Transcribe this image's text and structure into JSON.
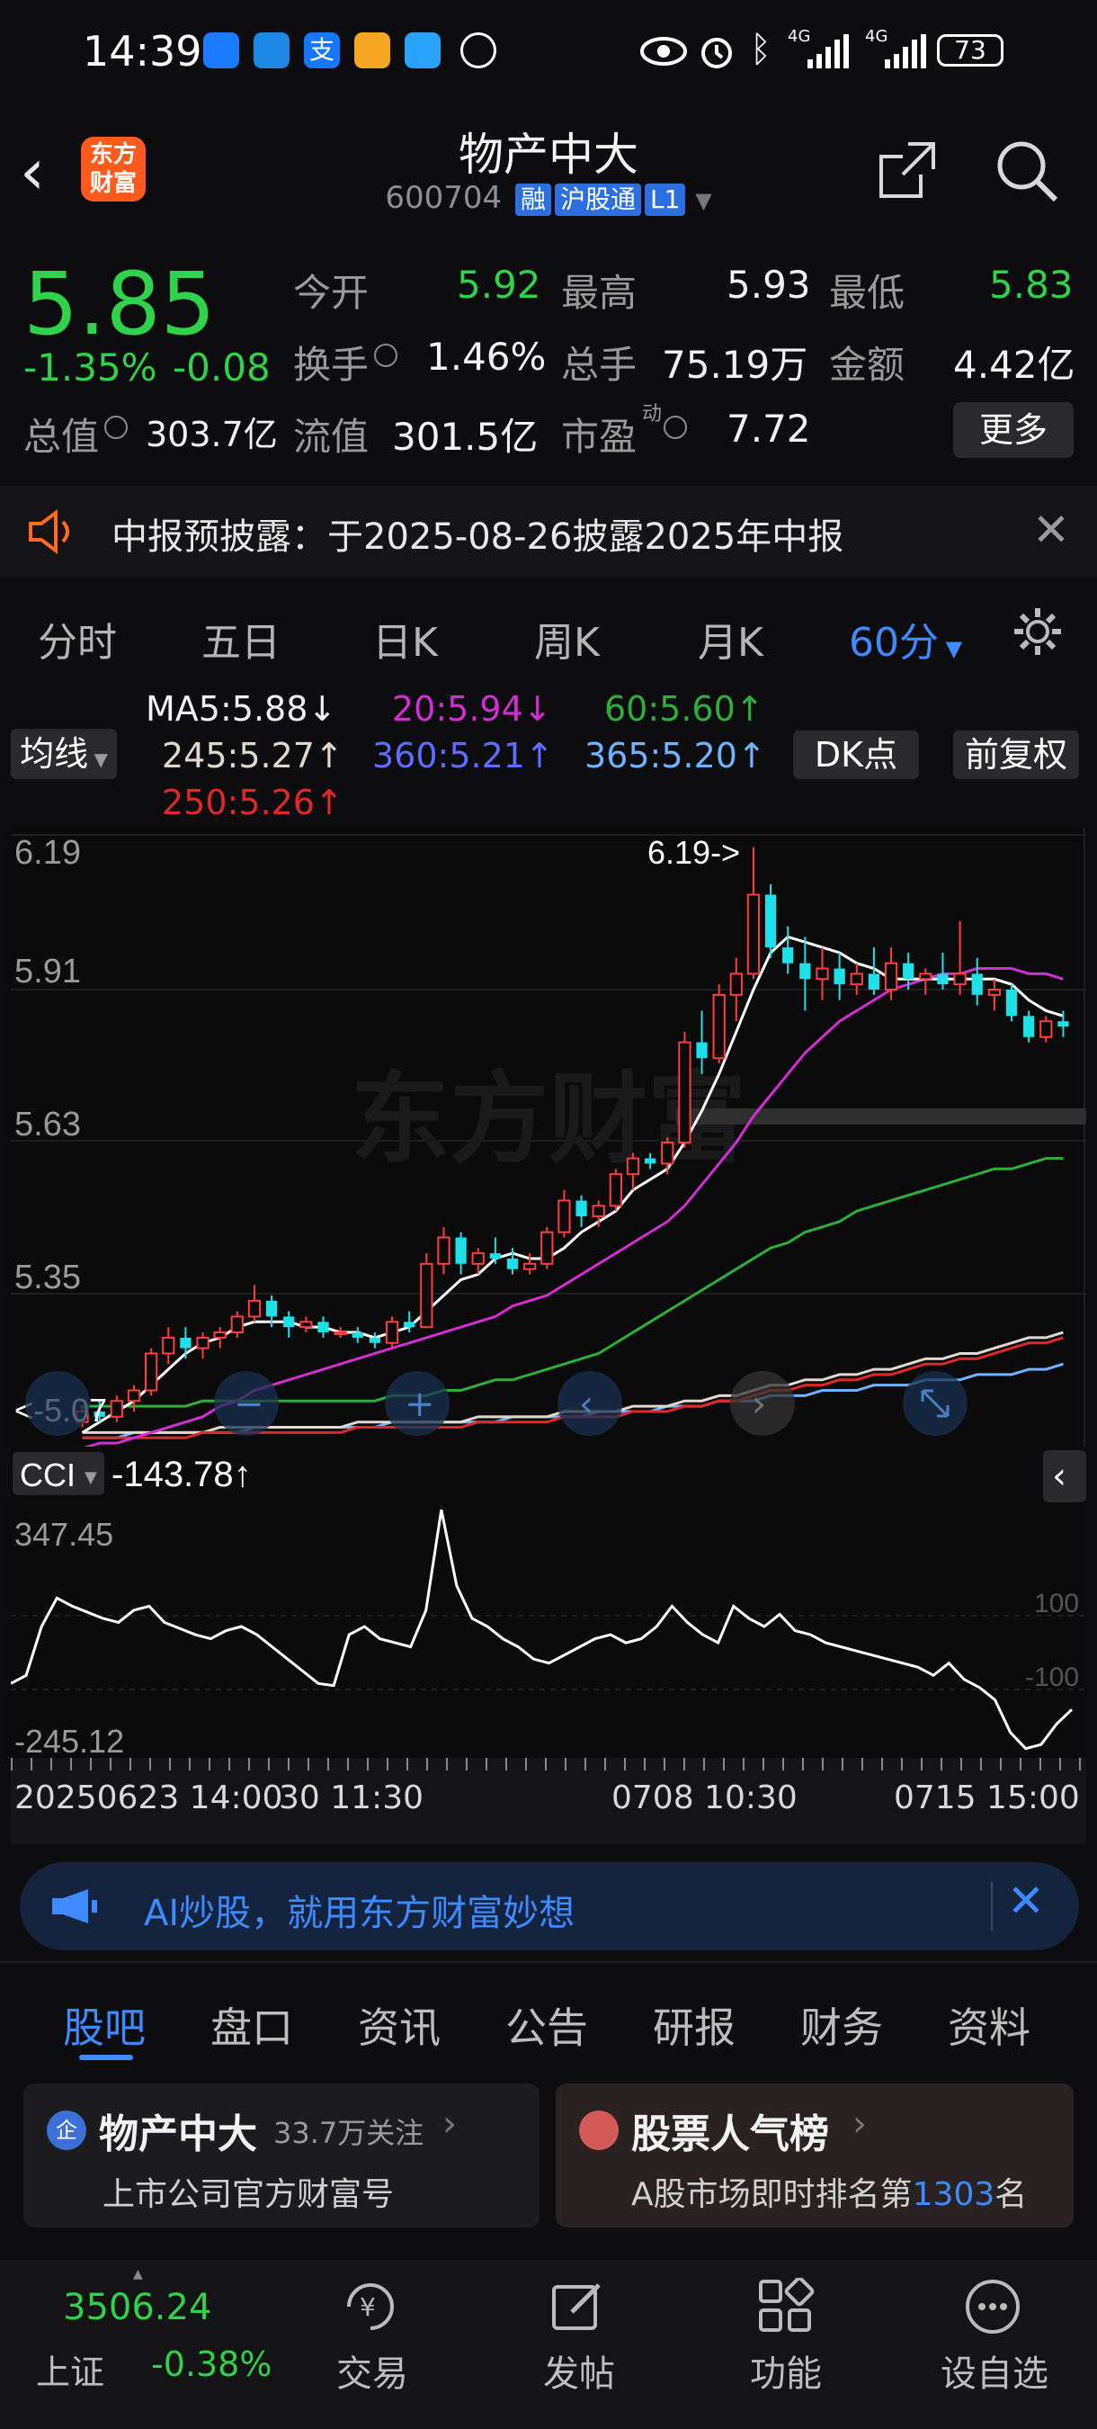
{
  "status_bar": {
    "time": "14:39",
    "battery": "73",
    "signal_1": "4G",
    "signal_2": "4G"
  },
  "header": {
    "title": "物产中大",
    "code": "600704",
    "tag_rong": "融",
    "tag_hgt": "沪股通",
    "tag_level": "L1",
    "logo_text": "东方\n财富"
  },
  "quote": {
    "price": "5.85",
    "change_pct": "-1.35%",
    "change_abs": "-0.08",
    "open_label": "今开",
    "open": "5.92",
    "high_label": "最高",
    "high": "5.93",
    "low_label": "最低",
    "low": "5.83",
    "turnover_label": "换手",
    "turnover": "1.46%",
    "volume_label": "总手",
    "volume": "75.19万",
    "amount_label": "金额",
    "amount": "4.42亿",
    "mktcap_label": "总值",
    "mktcap": "303.7亿",
    "float_label": "流值",
    "float": "301.5亿",
    "pe_label": "市盈",
    "pe_sup": "动",
    "pe": "7.72",
    "more": "更多"
  },
  "notice": {
    "text": "中报预披露：于2025-08-26披露2025年中报"
  },
  "period_tabs": [
    "分时",
    "五日",
    "日K",
    "周K",
    "月K",
    "60分"
  ],
  "indicators": {
    "ma_button": "均线",
    "ma5": "MA5:5.88↓",
    "ma20": "20:5.94↓",
    "ma60": "60:5.60↑",
    "ma245": "245:5.27↑",
    "ma360": "360:5.21↑",
    "ma365": "365:5.20↑",
    "ma250": "250:5.26↑",
    "dk_button": "DK点",
    "fq_button": "前复权"
  },
  "chart_data": {
    "type": "candlestick",
    "y_ticks": [
      "6.19",
      "5.91",
      "5.63",
      "5.35"
    ],
    "ylim": [
      5.05,
      6.21
    ],
    "max_marker": "6.19->",
    "min_marker": "<-5.07",
    "x_labels": [
      "20250623 14:00",
      "30 11:30",
      "0708 10:30",
      "0715 15:00"
    ],
    "watermark": "东方财富",
    "candles": [
      [
        5.1,
        5.13,
        5.09,
        5.12
      ],
      [
        5.12,
        5.14,
        5.1,
        5.11
      ],
      [
        5.11,
        5.15,
        5.1,
        5.14
      ],
      [
        5.14,
        5.17,
        5.12,
        5.16
      ],
      [
        5.16,
        5.24,
        5.15,
        5.23
      ],
      [
        5.23,
        5.28,
        5.21,
        5.26
      ],
      [
        5.26,
        5.28,
        5.22,
        5.24
      ],
      [
        5.24,
        5.27,
        5.22,
        5.26
      ],
      [
        5.26,
        5.28,
        5.24,
        5.27
      ],
      [
        5.27,
        5.31,
        5.26,
        5.3
      ],
      [
        5.3,
        5.36,
        5.29,
        5.33
      ],
      [
        5.33,
        5.34,
        5.28,
        5.3
      ],
      [
        5.3,
        5.31,
        5.26,
        5.28
      ],
      [
        5.28,
        5.3,
        5.27,
        5.29
      ],
      [
        5.29,
        5.3,
        5.26,
        5.27
      ],
      [
        5.27,
        5.28,
        5.26,
        5.27
      ],
      [
        5.27,
        5.28,
        5.25,
        5.26
      ],
      [
        5.26,
        5.27,
        5.24,
        5.25
      ],
      [
        5.25,
        5.3,
        5.24,
        5.29
      ],
      [
        5.29,
        5.31,
        5.27,
        5.28
      ],
      [
        5.28,
        5.42,
        5.28,
        5.4
      ],
      [
        5.4,
        5.47,
        5.38,
        5.45
      ],
      [
        5.45,
        5.46,
        5.38,
        5.4
      ],
      [
        5.4,
        5.43,
        5.38,
        5.42
      ],
      [
        5.42,
        5.45,
        5.4,
        5.41
      ],
      [
        5.41,
        5.43,
        5.38,
        5.39
      ],
      [
        5.39,
        5.42,
        5.38,
        5.4
      ],
      [
        5.4,
        5.47,
        5.39,
        5.46
      ],
      [
        5.46,
        5.54,
        5.45,
        5.52
      ],
      [
        5.52,
        5.53,
        5.47,
        5.49
      ],
      [
        5.49,
        5.52,
        5.47,
        5.51
      ],
      [
        5.51,
        5.58,
        5.5,
        5.57
      ],
      [
        5.57,
        5.61,
        5.54,
        5.6
      ],
      [
        5.6,
        5.61,
        5.58,
        5.59
      ],
      [
        5.59,
        5.64,
        5.57,
        5.63
      ],
      [
        5.63,
        5.84,
        5.62,
        5.82
      ],
      [
        5.82,
        5.88,
        5.76,
        5.79
      ],
      [
        5.79,
        5.93,
        5.78,
        5.91
      ],
      [
        5.91,
        5.98,
        5.86,
        5.95
      ],
      [
        5.95,
        6.19,
        5.94,
        6.1
      ],
      [
        6.1,
        6.12,
        5.98,
        6.0
      ],
      [
        6.0,
        6.04,
        5.95,
        5.97
      ],
      [
        5.97,
        6.02,
        5.88,
        5.94
      ],
      [
        5.94,
        6.0,
        5.9,
        5.96
      ],
      [
        5.96,
        5.99,
        5.9,
        5.93
      ],
      [
        5.93,
        5.97,
        5.91,
        5.95
      ],
      [
        5.95,
        6.0,
        5.91,
        5.92
      ],
      [
        5.92,
        6.0,
        5.9,
        5.97
      ],
      [
        5.97,
        5.99,
        5.92,
        5.94
      ],
      [
        5.94,
        5.96,
        5.91,
        5.95
      ],
      [
        5.95,
        5.99,
        5.92,
        5.93
      ],
      [
        5.93,
        6.05,
        5.91,
        5.95
      ],
      [
        5.95,
        5.98,
        5.89,
        5.91
      ],
      [
        5.91,
        5.94,
        5.88,
        5.92
      ],
      [
        5.92,
        5.93,
        5.86,
        5.87
      ],
      [
        5.87,
        5.88,
        5.82,
        5.83
      ],
      [
        5.83,
        5.87,
        5.82,
        5.86
      ],
      [
        5.86,
        5.88,
        5.83,
        5.85
      ]
    ],
    "ma5": [
      5.08,
      5.1,
      5.12,
      5.14,
      5.17,
      5.2,
      5.23,
      5.25,
      5.26,
      5.28,
      5.29,
      5.29,
      5.29,
      5.28,
      5.28,
      5.27,
      5.27,
      5.26,
      5.27,
      5.28,
      5.31,
      5.34,
      5.37,
      5.38,
      5.41,
      5.42,
      5.41,
      5.41,
      5.43,
      5.46,
      5.48,
      5.5,
      5.54,
      5.56,
      5.58,
      5.63,
      5.69,
      5.76,
      5.84,
      5.92,
      5.99,
      6.02,
      6.01,
      6.0,
      5.99,
      5.97,
      5.96,
      5.94,
      5.94,
      5.94,
      5.94,
      5.94,
      5.94,
      5.94,
      5.93,
      5.9,
      5.88,
      5.87
    ],
    "ma20": [
      5.05,
      5.06,
      5.06,
      5.07,
      5.08,
      5.09,
      5.1,
      5.11,
      5.13,
      5.14,
      5.16,
      5.17,
      5.18,
      5.19,
      5.2,
      5.21,
      5.22,
      5.23,
      5.24,
      5.25,
      5.26,
      5.27,
      5.28,
      5.29,
      5.3,
      5.32,
      5.33,
      5.34,
      5.36,
      5.38,
      5.4,
      5.42,
      5.44,
      5.46,
      5.48,
      5.51,
      5.55,
      5.59,
      5.63,
      5.68,
      5.72,
      5.76,
      5.8,
      5.83,
      5.86,
      5.88,
      5.9,
      5.92,
      5.93,
      5.94,
      5.95,
      5.95,
      5.96,
      5.96,
      5.96,
      5.95,
      5.95,
      5.94
    ],
    "ma60": [
      5.13,
      5.13,
      5.13,
      5.13,
      5.13,
      5.13,
      5.13,
      5.14,
      5.14,
      5.14,
      5.14,
      5.14,
      5.14,
      5.14,
      5.14,
      5.14,
      5.14,
      5.14,
      5.15,
      5.15,
      5.15,
      5.16,
      5.16,
      5.17,
      5.18,
      5.18,
      5.19,
      5.2,
      5.21,
      5.22,
      5.23,
      5.25,
      5.27,
      5.29,
      5.31,
      5.33,
      5.35,
      5.37,
      5.39,
      5.41,
      5.43,
      5.44,
      5.46,
      5.47,
      5.48,
      5.5,
      5.51,
      5.52,
      5.53,
      5.54,
      5.55,
      5.56,
      5.57,
      5.58,
      5.58,
      5.59,
      5.6,
      5.6
    ],
    "ma245": [
      5.08,
      5.08,
      5.08,
      5.08,
      5.08,
      5.08,
      5.08,
      5.08,
      5.09,
      5.09,
      5.09,
      5.09,
      5.09,
      5.09,
      5.09,
      5.09,
      5.1,
      5.1,
      5.1,
      5.1,
      5.1,
      5.1,
      5.1,
      5.11,
      5.11,
      5.11,
      5.11,
      5.11,
      5.12,
      5.12,
      5.12,
      5.12,
      5.13,
      5.13,
      5.13,
      5.14,
      5.14,
      5.15,
      5.15,
      5.16,
      5.17,
      5.17,
      5.18,
      5.18,
      5.19,
      5.19,
      5.2,
      5.2,
      5.21,
      5.22,
      5.22,
      5.23,
      5.23,
      5.24,
      5.25,
      5.26,
      5.26,
      5.27
    ],
    "ma250": [
      5.07,
      5.07,
      5.07,
      5.07,
      5.07,
      5.07,
      5.07,
      5.08,
      5.08,
      5.08,
      5.08,
      5.08,
      5.08,
      5.08,
      5.08,
      5.08,
      5.09,
      5.09,
      5.09,
      5.09,
      5.09,
      5.09,
      5.09,
      5.1,
      5.1,
      5.1,
      5.1,
      5.1,
      5.11,
      5.11,
      5.11,
      5.11,
      5.12,
      5.12,
      5.12,
      5.13,
      5.13,
      5.14,
      5.14,
      5.15,
      5.16,
      5.16,
      5.17,
      5.17,
      5.18,
      5.18,
      5.19,
      5.19,
      5.2,
      5.21,
      5.21,
      5.22,
      5.22,
      5.23,
      5.24,
      5.25,
      5.25,
      5.26
    ],
    "ma360": [
      5.07,
      5.07,
      5.07,
      5.08,
      5.08,
      5.08,
      5.08,
      5.08,
      5.08,
      5.08,
      5.09,
      5.09,
      5.09,
      5.09,
      5.09,
      5.09,
      5.09,
      5.09,
      5.1,
      5.1,
      5.1,
      5.1,
      5.1,
      5.1,
      5.1,
      5.11,
      5.11,
      5.11,
      5.11,
      5.11,
      5.12,
      5.12,
      5.12,
      5.12,
      5.13,
      5.13,
      5.13,
      5.14,
      5.14,
      5.14,
      5.15,
      5.15,
      5.15,
      5.16,
      5.16,
      5.16,
      5.17,
      5.17,
      5.17,
      5.18,
      5.18,
      5.18,
      5.19,
      5.19,
      5.19,
      5.2,
      5.2,
      5.21
    ]
  },
  "cci": {
    "label": "CCI",
    "value": "-143.78↑",
    "top_label": "347.45",
    "bottom_label": "-245.12",
    "level_hi": "100",
    "level_lo": "-100",
    "range": [
      -245.12,
      347.45
    ],
    "values": [
      -80,
      -60,
      60,
      130,
      110,
      95,
      80,
      70,
      100,
      110,
      70,
      55,
      40,
      30,
      50,
      60,
      40,
      10,
      -20,
      -50,
      -80,
      -85,
      40,
      60,
      30,
      20,
      10,
      100,
      347,
      160,
      80,
      60,
      30,
      10,
      -20,
      -30,
      -10,
      10,
      30,
      40,
      20,
      30,
      60,
      110,
      70,
      40,
      20,
      110,
      80,
      60,
      90,
      50,
      40,
      20,
      10,
      0,
      -10,
      -20,
      -30,
      -40,
      -60,
      -30,
      -70,
      -90,
      -120,
      -200,
      -240,
      -230,
      -180,
      -143.78
    ]
  },
  "ai_banner": {
    "text": "AI炒股，就用东方财富妙想"
  },
  "info_tabs": [
    "股吧",
    "盘口",
    "资讯",
    "公告",
    "研报",
    "财务",
    "资料"
  ],
  "card_left": {
    "name": "物产中大",
    "followers": "33.7万关注",
    "subtitle": "上市公司官方财富号",
    "icon_text": "企"
  },
  "card_right": {
    "title": "股票人气榜",
    "rank_prefix": "A股市场即时排名第",
    "rank": "1303",
    "rank_suffix": "名"
  },
  "bottom_nav": {
    "index_value": "3506.24",
    "index_name": "上证",
    "index_change": "-0.38%",
    "items": [
      "交易",
      "发帖",
      "功能",
      "设自选"
    ]
  },
  "colors": {
    "up": "#ff3d3d",
    "down": "#2fd24a",
    "candle_down": "#1ee0e8",
    "accent": "#3d8bff",
    "bg": "#0d0d0f"
  }
}
